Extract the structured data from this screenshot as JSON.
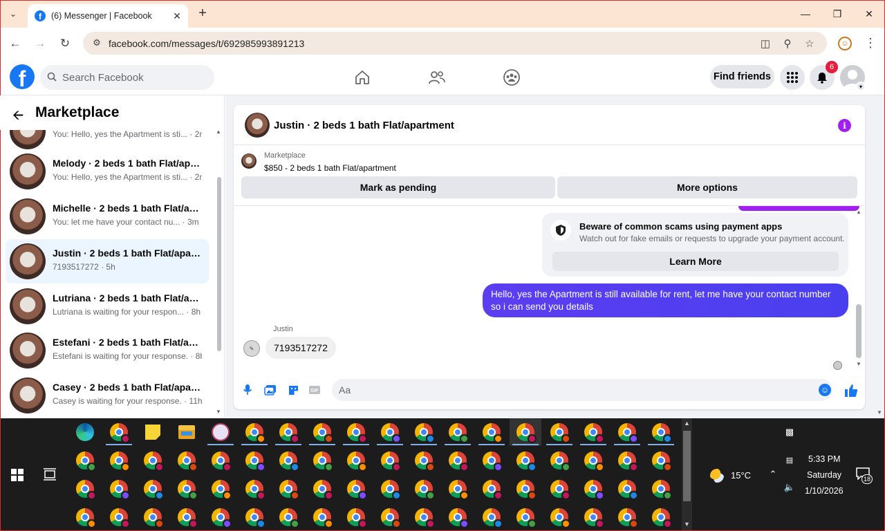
{
  "browser": {
    "tab_title": "(6) Messenger | Facebook",
    "url": "facebook.com/messages/t/692985993891213"
  },
  "fb_header": {
    "search_placeholder": "Search Facebook",
    "find_friends_label": "Find friends",
    "notification_count": "6"
  },
  "sidebar": {
    "title": "Marketplace",
    "conversations": [
      {
        "name": "",
        "preview": "You: Hello, yes the Apartment is sti... · 2m",
        "active": false
      },
      {
        "name": "Melody · 2 beds 1 bath Flat/apartment",
        "preview": "You: Hello, yes the Apartment is sti... · 2m",
        "active": false
      },
      {
        "name": "Michelle · 2 beds 1 bath Flat/apartment",
        "preview": "You: let me have your contact nu... · 3m",
        "active": false
      },
      {
        "name": "Justin · 2 beds 1 bath Flat/apartment",
        "preview": "7193517272 · 5h",
        "active": true
      },
      {
        "name": "Lutriana · 2 beds 1 bath Flat/apartment",
        "preview": "Lutriana is waiting for your respon... · 8h",
        "active": false
      },
      {
        "name": "Estefani · 2 beds 1 bath Flat/apartment",
        "preview": "Estefani is waiting for your response. · 8h",
        "active": false
      },
      {
        "name": "Casey · 2 beds 1 bath Flat/apartment",
        "preview": "Casey is waiting for your response. · 11h",
        "active": false
      }
    ]
  },
  "chat": {
    "title": "Justin · 2 beds 1 bath Flat/apartment",
    "marketplace_label": "Marketplace",
    "listing": "$850 - 2 beds 1 bath Flat/apartment",
    "mark_pending_label": "Mark as pending",
    "more_options_label": "More options",
    "scam_title": "Beware of common scams using payment apps",
    "scam_text": "Watch out for fake emails or requests to upgrade your payment account.",
    "learn_more_label": "Learn More",
    "outgoing_message": "Hello, yes the Apartment is still available for rent, let me have your contact number so i can send you details",
    "sender_name": "Justin",
    "incoming_message": "7193517272",
    "composer_placeholder": "Aa"
  },
  "taskbar": {
    "temperature": "15°C",
    "time": "5:33 PM",
    "day": "Saturday",
    "date": "1/10/2026",
    "notification_count": "18"
  },
  "colors": {
    "fb_blue": "#1877f2",
    "messenger_purple": "#a020f0",
    "outgoing_bubble": "#4a3fef",
    "active_row": "#ebf5ff"
  }
}
